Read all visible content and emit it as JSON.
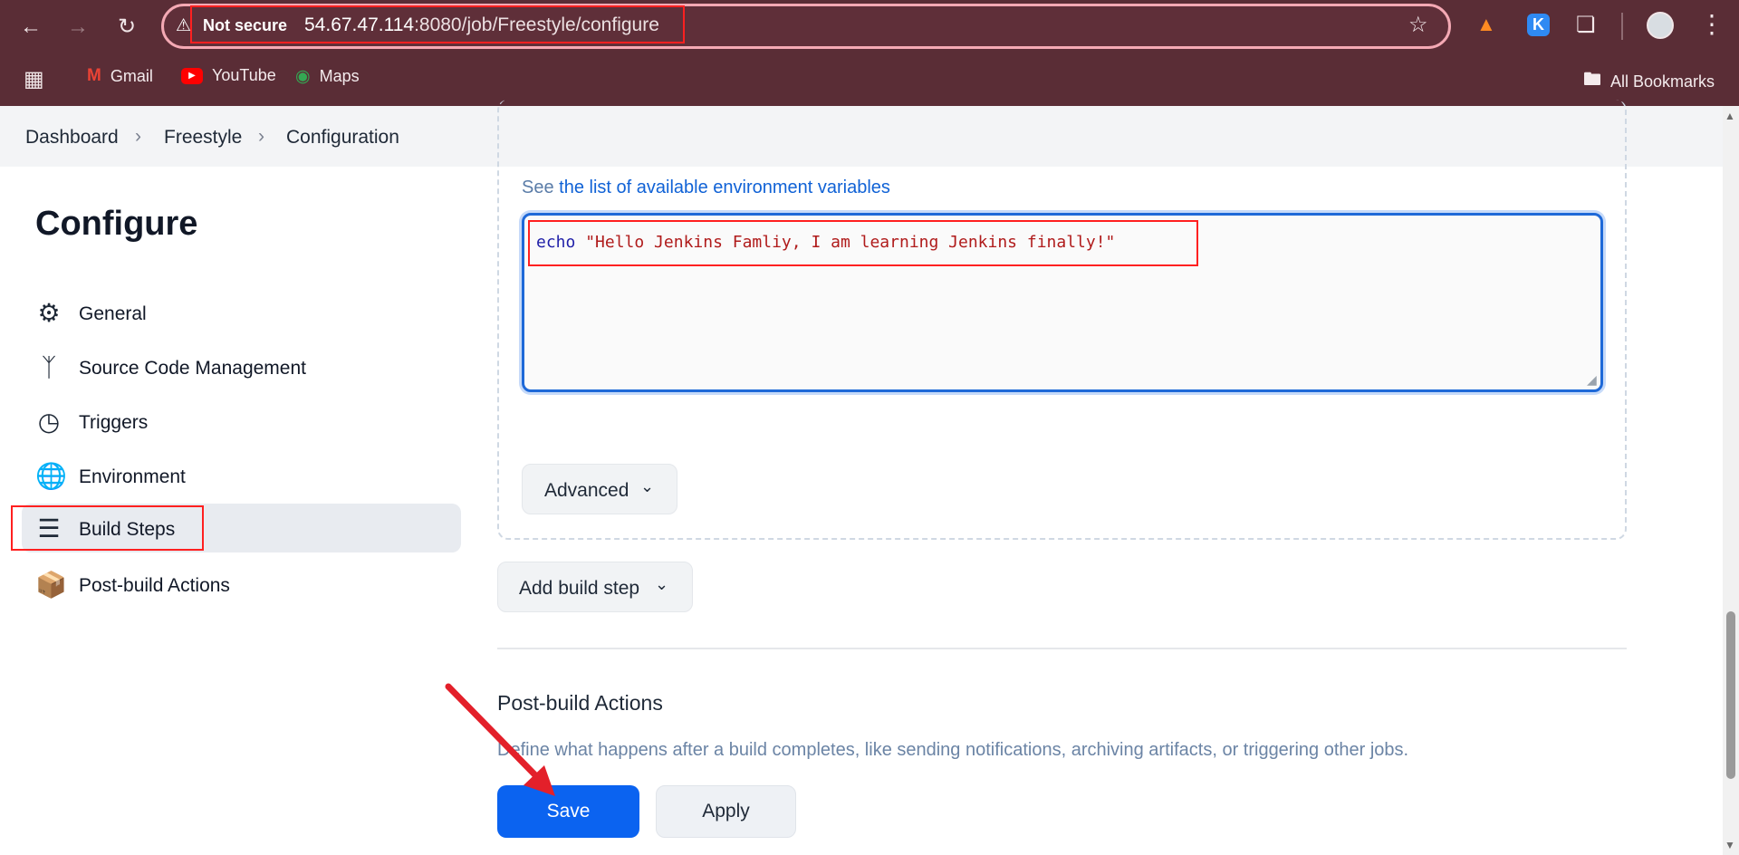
{
  "browser": {
    "security_label": "Not secure",
    "url_host": "54.67.47.114",
    "url_rest": ":8080/job/Freestyle/configure",
    "bookmarks": [
      {
        "label": "Gmail",
        "icon": "gmail-icon"
      },
      {
        "label": "YouTube",
        "icon": "youtube-icon"
      },
      {
        "label": "Maps",
        "icon": "maps-icon"
      }
    ],
    "all_bookmarks": "All Bookmarks"
  },
  "breadcrumb": [
    "Dashboard",
    "Freestyle",
    "Configuration"
  ],
  "sidebar": {
    "title": "Configure",
    "items": [
      {
        "label": "General",
        "icon": "gear-icon"
      },
      {
        "label": "Source Code Management",
        "icon": "branch-icon"
      },
      {
        "label": "Triggers",
        "icon": "clock-icon"
      },
      {
        "label": "Environment",
        "icon": "globe-icon"
      },
      {
        "label": "Build Steps",
        "icon": "list-icon",
        "active": true
      },
      {
        "label": "Post-build Actions",
        "icon": "package-icon"
      }
    ]
  },
  "build_step": {
    "env_prefix": "See ",
    "env_link": "the list of available environment variables",
    "command_keyword": "echo",
    "command_string": " \"Hello Jenkins Famliy, I am learning Jenkins finally!\"",
    "advanced_label": "Advanced"
  },
  "add_build_step_label": "Add build step",
  "post_build": {
    "title": "Post-build Actions",
    "description": "Define what happens after a build completes, like sending notifications, archiving artifacts, or triggering other jobs."
  },
  "actions": {
    "save": "Save",
    "apply": "Apply"
  },
  "colors": {
    "chrome": "#5a2d36",
    "accent": "#0b63f0",
    "highlight": "#ff2020"
  }
}
